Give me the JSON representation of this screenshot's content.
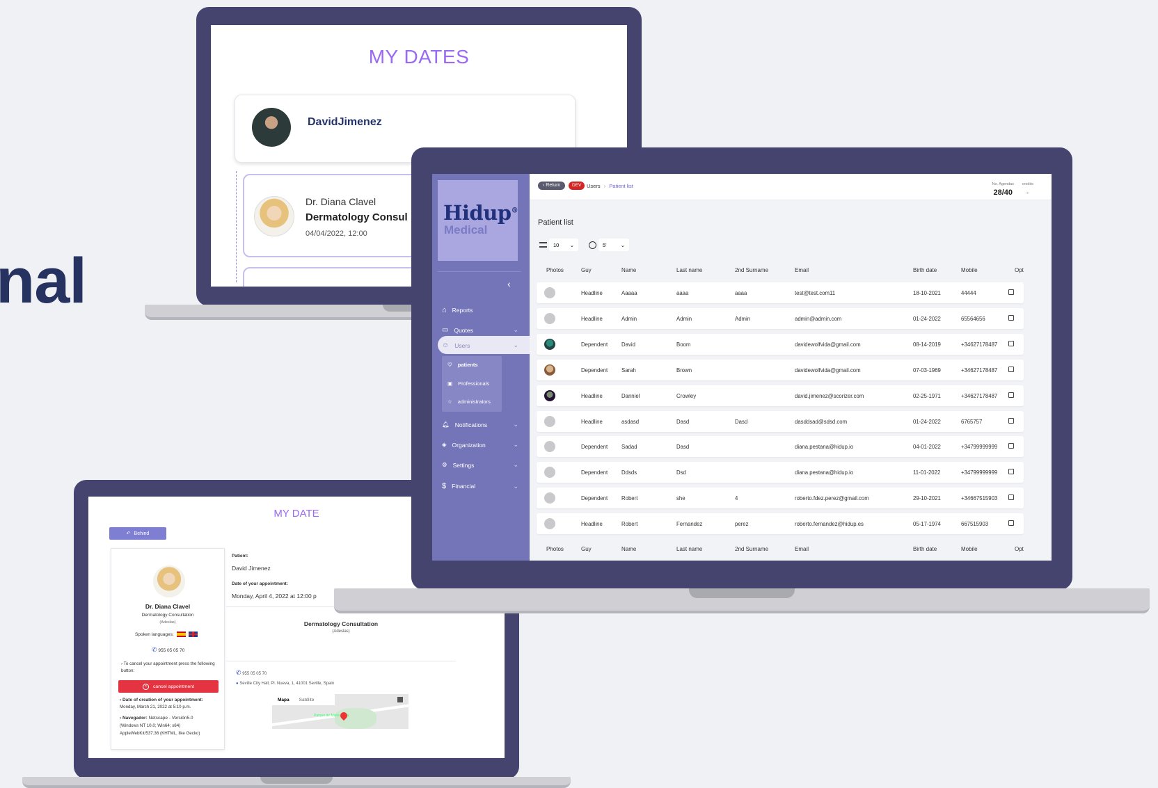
{
  "side_text": "nal",
  "laptop_dates": {
    "title": "MY DATES",
    "user_name": "DavidJimenez",
    "doctor": "Dr. Diana Clavel",
    "consultation": "Dermatology Consul",
    "datetime": "04/04/2022, 12:00"
  },
  "app": {
    "logo_main": "Hidup",
    "logo_sub": "Medical",
    "logo_reg": "®",
    "breadcrumb": {
      "return": "Return",
      "badge": "DEV",
      "users": "Users",
      "sep": "›",
      "current": "Patient list"
    },
    "agendas": {
      "label": "No. Agendas",
      "value": "28/40",
      "credits_label": "credits",
      "credits_value": "-"
    },
    "page_title": "Patient list",
    "page_size": "10",
    "refresh": "5'",
    "sidebar": {
      "items": [
        {
          "label": "Reports"
        },
        {
          "label": "Quotes"
        },
        {
          "label": "Users"
        },
        {
          "label": "Notifications"
        },
        {
          "label": "Organization"
        },
        {
          "label": "Settings"
        },
        {
          "label": "Financial"
        }
      ],
      "sub_items": [
        {
          "label": "patients"
        },
        {
          "label": "Professionals"
        },
        {
          "label": "administrators"
        }
      ]
    },
    "columns": [
      "Photos",
      "Guy",
      "Name",
      "Last name",
      "2nd Surname",
      "Email",
      "Birth date",
      "Mobile",
      "Opt"
    ],
    "rows": [
      {
        "guy": "Headline",
        "name": "Aaaaa",
        "last": "aaaa",
        "second": "aaaa",
        "email": "test@test.com11",
        "birth": "18-10-2021",
        "mobile": "44444",
        "photo": "none"
      },
      {
        "guy": "Headline",
        "name": "Admin",
        "last": "Admin",
        "second": "Admin",
        "email": "admin@admin.com",
        "birth": "01-24-2022",
        "mobile": "65564656",
        "photo": "none"
      },
      {
        "guy": "Dependent",
        "name": "David",
        "last": "Boom",
        "second": "",
        "email": "davidewolfvida@gmail.com",
        "birth": "08-14-2019",
        "mobile": "+34627178487",
        "photo": "teal"
      },
      {
        "guy": "Dependent",
        "name": "Sarah",
        "last": "Brown",
        "second": "",
        "email": "davidewolfvida@gmail.com",
        "birth": "07-03-1969",
        "mobile": "+34627178487",
        "photo": "tan"
      },
      {
        "guy": "Headline",
        "name": "Danniel",
        "last": "Crowley",
        "second": "",
        "email": "david.jimenez@scorizer.com",
        "birth": "02-25-1971",
        "mobile": "+34627178487",
        "photo": "dark"
      },
      {
        "guy": "Headline",
        "name": "asdasd",
        "last": "Dasd",
        "second": "Dasd",
        "email": "dasddsad@sdsd.com",
        "birth": "01-24-2022",
        "mobile": "6765757",
        "photo": "none"
      },
      {
        "guy": "Dependent",
        "name": "Sadad",
        "last": "Dasd",
        "second": "",
        "email": "diana.pestana@hidup.io",
        "birth": "04-01-2022",
        "mobile": "+34799999999",
        "photo": "none"
      },
      {
        "guy": "Dependent",
        "name": "Ddsds",
        "last": "Dsd",
        "second": "",
        "email": "diana.pestana@hidup.io",
        "birth": "11-01-2022",
        "mobile": "+34799999999",
        "photo": "none"
      },
      {
        "guy": "Dependent",
        "name": "Robert",
        "last": "she",
        "second": "4",
        "email": "roberto.fdez.perez@gmail.com",
        "birth": "29-10-2021",
        "mobile": "+34667515903",
        "photo": "none"
      },
      {
        "guy": "Headline",
        "name": "Robert",
        "last": "Fernandez",
        "second": "perez",
        "email": "roberto.fernandez@hidup.es",
        "birth": "05-17-1974",
        "mobile": "667515903",
        "photo": "none"
      }
    ]
  },
  "laptop_date": {
    "title": "MY DATE",
    "back": "Behind",
    "doctor": "Dr. Diana Clavel",
    "specialty": "Dermatology Consultation",
    "insurer": "(Adeslas)",
    "languages_label": "Spoken languages:",
    "phone": "955 05 05 70",
    "cancel_note": "› To cancel your appointment press the following button:",
    "cancel_button": "cancel appointment",
    "creation_label": "› Date of creation of your appointment:",
    "creation_value": "Monday, March 21, 2022 at 5:10 p.m.",
    "browser_label": "› Navegador:",
    "browser_value": "Netscape - Versión5.0",
    "browser_line2": "(Windows NT 10.0; Win64; x64)",
    "browser_line3": "AppleWebKit/537.36 (KHTML, like Gecko)",
    "patient_label": "Patient:",
    "patient_value": "David Jimenez",
    "date_label": "Date of your appointment:",
    "date_value": "Monday, April 4, 2022 at 12:00 p",
    "consult_title": "Dermatology Consultation",
    "consult_insurer": "(Adeslas)",
    "phone2": "955 05 05 70",
    "address": "Seville City Hall, Pl. Nueva, 1, 41001 Seville, Spain",
    "map_tab1": "Mapa",
    "map_tab2": "Satélite",
    "map_label": "Parque de Maria Luisa"
  }
}
